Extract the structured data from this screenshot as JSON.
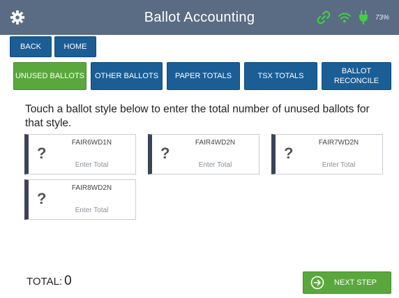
{
  "header": {
    "title": "Ballot Accounting",
    "battery": "73%"
  },
  "nav": {
    "back_label": "BACK",
    "home_label": "HOME"
  },
  "tabs": [
    {
      "label": "UNUSED BALLOTS",
      "active": true
    },
    {
      "label": "OTHER BALLOTS",
      "active": false
    },
    {
      "label": "PAPER TOTALS",
      "active": false
    },
    {
      "label": "TSX TOTALS",
      "active": false
    },
    {
      "label": "BALLOT RECONCILE",
      "active": false
    }
  ],
  "instructions": "Touch a ballot style below to enter the total number of unused ballots for that style.",
  "ballot_styles": [
    {
      "symbol": "?",
      "name": "FAIR6WD1N",
      "placeholder": "Enter Total"
    },
    {
      "symbol": "?",
      "name": "FAIR4WD2N",
      "placeholder": "Enter Total"
    },
    {
      "symbol": "?",
      "name": "FAIR7WD2N",
      "placeholder": "Enter Total"
    },
    {
      "symbol": "?",
      "name": "FAIR8WD2N",
      "placeholder": "Enter Total"
    }
  ],
  "total": {
    "label": "TOTAL:",
    "value": "0"
  },
  "next_step_label": "NEXT STEP",
  "icons": {
    "settings": "gear-icon",
    "link": "link-icon",
    "wifi": "wifi-icon",
    "power": "power-plug-icon",
    "next": "arrow-circle-right-icon"
  },
  "colors": {
    "header": "#5a6b84",
    "button_blue": "#1b5e96",
    "active_green": "#5aa83d",
    "status_green": "#3fd13f",
    "card_stripe": "#3b4358"
  }
}
